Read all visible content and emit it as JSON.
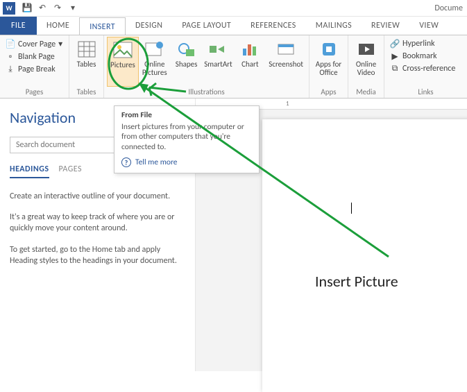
{
  "qat": {
    "save": "💾",
    "undo": "↶",
    "redo": "↷",
    "title": "Docume"
  },
  "tabs": {
    "file": "FILE",
    "items": [
      "HOME",
      "INSERT",
      "DESIGN",
      "PAGE LAYOUT",
      "REFERENCES",
      "MAILINGS",
      "REVIEW",
      "VIEW"
    ],
    "activeIndex": 1
  },
  "ribbon": {
    "pages": {
      "label": "Pages",
      "cover": "Cover Page",
      "blank": "Blank Page",
      "break": "Page Break"
    },
    "tables": {
      "label": "Tables",
      "btn": "Tables"
    },
    "illus": {
      "label": "Illustrations",
      "pictures": "Pictures",
      "online": "Online\nPictures",
      "shapes": "Shapes",
      "smartart": "SmartArt",
      "chart": "Chart",
      "screenshot": "Screenshot"
    },
    "apps": {
      "label": "Apps",
      "btn": "Apps for\nOffice"
    },
    "media": {
      "label": "Media",
      "btn": "Online\nVideo"
    },
    "links": {
      "label": "Links",
      "hyperlink": "Hyperlink",
      "bookmark": "Bookmark",
      "crossref": "Cross-reference"
    }
  },
  "tooltip": {
    "title": "From File",
    "body": "Insert pictures from your computer or from other computers that you're connected to.",
    "more": "Tell me more"
  },
  "nav": {
    "title": "Navigation",
    "search_placeholder": "Search document",
    "tabs": {
      "headings": "HEADINGS",
      "pages": "PAGES"
    },
    "tip1": "Create an interactive outline of your document.",
    "tip2": "It's a great way to keep track of where you are or quickly move your content around.",
    "tip3": "To get started, go to the Home tab and apply Heading styles to the headings in your document."
  },
  "ruler": {
    "one": "1"
  },
  "annotation": "Insert Picture"
}
